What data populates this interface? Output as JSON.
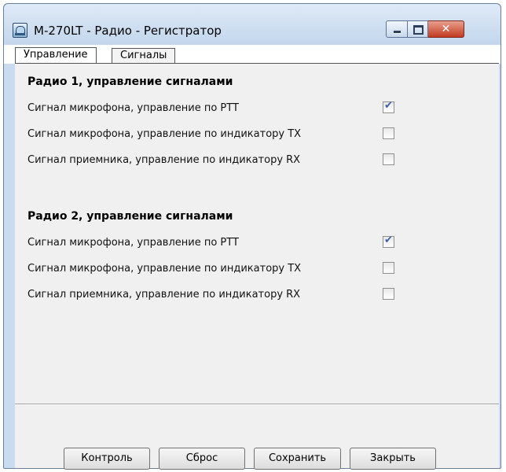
{
  "window": {
    "title": "M-270LT - Радио - Регистратор",
    "controls": {
      "minimize": "minimize",
      "maximize": "maximize",
      "close": "✕"
    }
  },
  "tabs": [
    {
      "label": "Управление",
      "active": true
    },
    {
      "label": "Сигналы",
      "active": false
    }
  ],
  "radio1": {
    "title": "Радио 1, управление сигналами",
    "rows": [
      {
        "label": "Сигнал микрофона, управление по PTT",
        "checked": true
      },
      {
        "label": "Сигнал микрофона, управление по индикатору TX",
        "checked": false
      },
      {
        "label": "Сигнал приемника, управление по индикатору RX",
        "checked": false
      }
    ]
  },
  "radio2": {
    "title": "Радио 2, управление сигналами",
    "rows": [
      {
        "label": "Сигнал микрофона, управление по PTT",
        "checked": true
      },
      {
        "label": "Сигнал микрофона, управление по индикатору TX",
        "checked": false
      },
      {
        "label": "Сигнал приемника, управление по индикатору RX",
        "checked": false
      }
    ]
  },
  "buttons": {
    "control": "Контроль",
    "reset": "Сброс",
    "save": "Сохранить",
    "close": "Закрыть"
  },
  "colors": {
    "titlebar": "#c9dbee",
    "close_button": "#c33a22",
    "check_mark": "#3b5fa8"
  }
}
